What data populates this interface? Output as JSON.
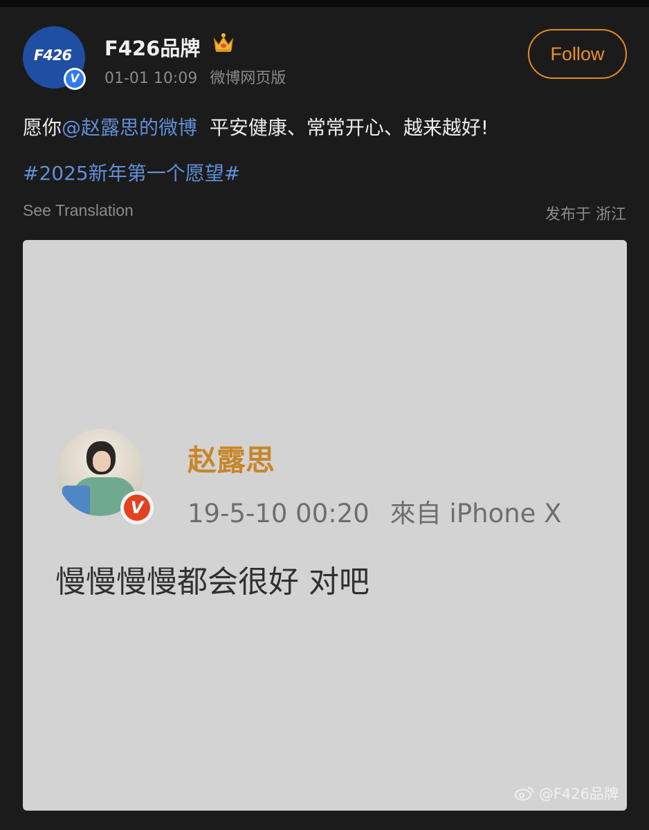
{
  "author": {
    "avatar_text": "F426",
    "verified_mark": "V",
    "name": "F426品牌",
    "badge_icon": "crown-icon",
    "timestamp": "01-01 10:09",
    "source": "微博网页版"
  },
  "follow_button": {
    "label": "Follow"
  },
  "post": {
    "prefix": "愿你",
    "mention": "@赵露思的微博",
    "suffix": "  平安健康、常常开心、越来越好!",
    "hashtag": "#2025新年第一个愿望#",
    "translate_label": "See Translation",
    "location": "发布于 浙江"
  },
  "embedded_image": {
    "verified_mark": "V",
    "name": "赵露思",
    "timestamp": "19-5-10 00:20",
    "source": "來自 iPhone X",
    "text": "慢慢慢慢都会很好 对吧",
    "watermark": "@F426品牌"
  },
  "colors": {
    "background": "#1b1b1c",
    "link": "#5f8fd6",
    "follow_accent": "#ec9024",
    "avatar_blue": "#1f4fa2",
    "inner_name": "#c7862a"
  }
}
